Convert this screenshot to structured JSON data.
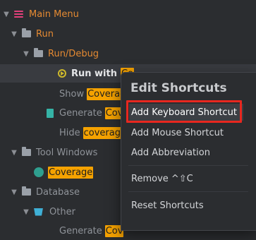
{
  "tree": {
    "main_menu": "Main Menu",
    "run": "Run",
    "run_debug": "Run/Debug",
    "run_with_prefix": "Run with",
    "run_with_hl": "Co",
    "show_prefix": "Show",
    "show_hl": "Coverage",
    "generate_prefix": "Generate",
    "generate_hl": "Cov",
    "hide_prefix": "Hide",
    "hide_hl": "coverage",
    "tool_windows": "Tool Windows",
    "coverage_hl": "Coverage",
    "database": "Database",
    "other": "Other",
    "generate2_hl": "Cov"
  },
  "popup": {
    "title": "Edit Shortcuts",
    "items": {
      "add_keyboard": "Add Keyboard Shortcut",
      "add_mouse": "Add Mouse Shortcut",
      "add_abbreviation": "Add Abbreviation",
      "remove": "Remove ^⇧C",
      "reset": "Reset Shortcuts"
    }
  },
  "colors": {
    "background": "#2b2d30",
    "highlight": "#f5a200",
    "accent_orange": "#e58a32",
    "focus_outline": "#e8271f"
  }
}
